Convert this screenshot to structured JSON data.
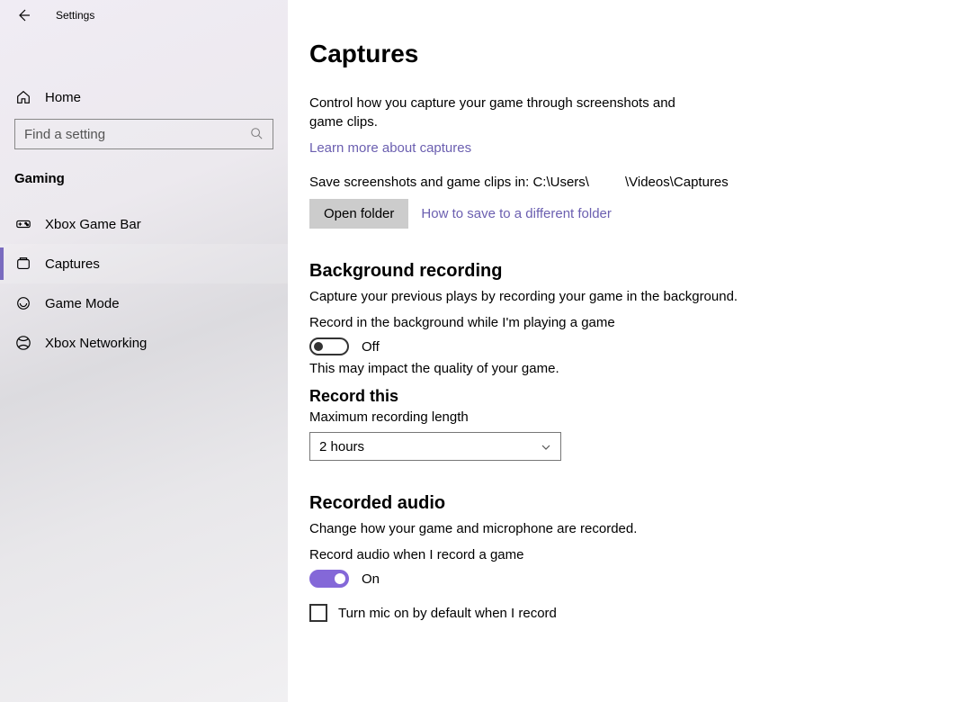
{
  "app_title": "Settings",
  "sidebar": {
    "home_label": "Home",
    "search_placeholder": "Find a setting",
    "section_label": "Gaming",
    "items": [
      {
        "id": "xbox-game-bar",
        "label": "Xbox Game Bar",
        "active": false
      },
      {
        "id": "captures",
        "label": "Captures",
        "active": true
      },
      {
        "id": "game-mode",
        "label": "Game Mode",
        "active": false
      },
      {
        "id": "xbox-networking",
        "label": "Xbox Networking",
        "active": false
      }
    ]
  },
  "page": {
    "title": "Captures",
    "intro": "Control how you capture your game through screenshots and game clips.",
    "learn_more": "Learn more about captures",
    "save_path_prefix": "Save screenshots and game clips in: C:\\Users\\",
    "save_path_suffix": "\\Videos\\Captures",
    "open_folder_btn": "Open folder",
    "how_to_link": "How to save to a different folder",
    "bg_recording": {
      "heading": "Background recording",
      "desc": "Capture your previous plays by recording your game in the background.",
      "toggle_label": "Record in the background while I'm playing a game",
      "toggle_state": "Off",
      "note": "This may impact the quality of your game."
    },
    "record_this": {
      "heading": "Record this",
      "max_label": "Maximum recording length",
      "selected": "2 hours"
    },
    "recorded_audio": {
      "heading": "Recorded audio",
      "desc": "Change how your game and microphone are recorded.",
      "toggle_label": "Record audio when I record a game",
      "toggle_state": "On",
      "mic_checkbox_label": "Turn mic on by default when I record"
    }
  }
}
